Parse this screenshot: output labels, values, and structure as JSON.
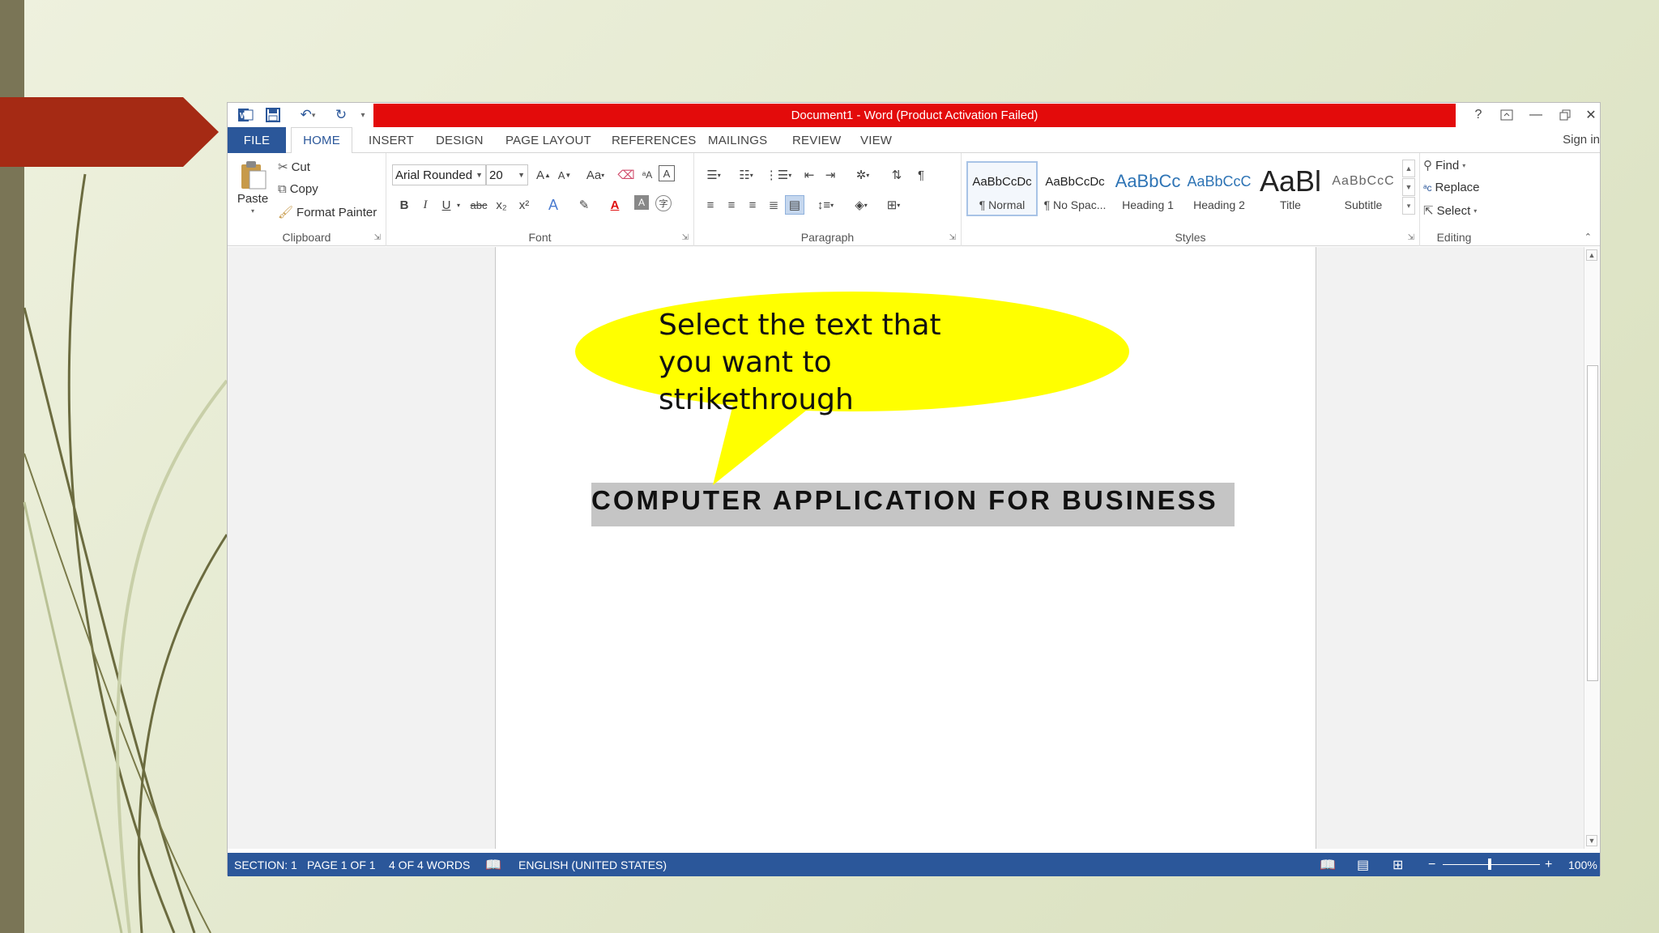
{
  "colors": {
    "accent": "#2b579a",
    "title_bar_warning": "#e30b0b",
    "callout_fill": "#ffff00",
    "selection_highlight": "#c5c5c5",
    "slide_arrow": "#a52a14"
  },
  "window": {
    "title": "Document1 -  Word (Product Activation Failed)",
    "qat": {
      "word_icon": "word-logo-icon",
      "save_icon": "save-icon",
      "undo_icon": "undo-icon",
      "redo_icon": "redo-icon",
      "customize_icon": "customize-qat-icon"
    },
    "controls": {
      "help": "?",
      "ribbon_display": "ribbon-display-icon",
      "minimize": "minimize-icon",
      "restore": "restore-icon",
      "close": "close-icon"
    },
    "sign_in": "Sign in"
  },
  "tabs": [
    "FILE",
    "HOME",
    "INSERT",
    "DESIGN",
    "PAGE LAYOUT",
    "REFERENCES",
    "MAILINGS",
    "REVIEW",
    "VIEW"
  ],
  "ribbon": {
    "clipboard": {
      "label": "Clipboard",
      "paste": "Paste",
      "cut": "Cut",
      "copy": "Copy",
      "format_painter": "Format Painter"
    },
    "font": {
      "label": "Font",
      "font_name": "Arial Rounded",
      "font_size": "20",
      "change_case": "Aa",
      "bold": "B",
      "italic": "I",
      "underline": "U",
      "strikethrough": "abc",
      "subscript": "x₂",
      "superscript": "x²"
    },
    "paragraph": {
      "label": "Paragraph",
      "show_marks": "¶"
    },
    "styles": {
      "label": "Styles",
      "items": [
        {
          "sample": "AaBbCcDc",
          "name": "¶ Normal"
        },
        {
          "sample": "AaBbCcDc",
          "name": "¶ No Spac..."
        },
        {
          "sample": "AaBbCc",
          "name": "Heading 1"
        },
        {
          "sample": "AaBbCcC",
          "name": "Heading 2"
        },
        {
          "sample": "AaBl",
          "name": "Title"
        },
        {
          "sample": "AaBbCcC",
          "name": "Subtitle"
        }
      ]
    },
    "editing": {
      "label": "Editing",
      "find": "Find",
      "replace": "Replace",
      "select": "Select"
    }
  },
  "document": {
    "callout": "Select the text that you want to strikethrough",
    "selected_text": "COMPUTER APPLICATION FOR BUSINESS"
  },
  "status_bar": {
    "section": "SECTION: 1",
    "page": "PAGE 1 OF 1",
    "words": "4 OF 4 WORDS",
    "language": "ENGLISH (UNITED STATES)",
    "zoom": "100%"
  }
}
